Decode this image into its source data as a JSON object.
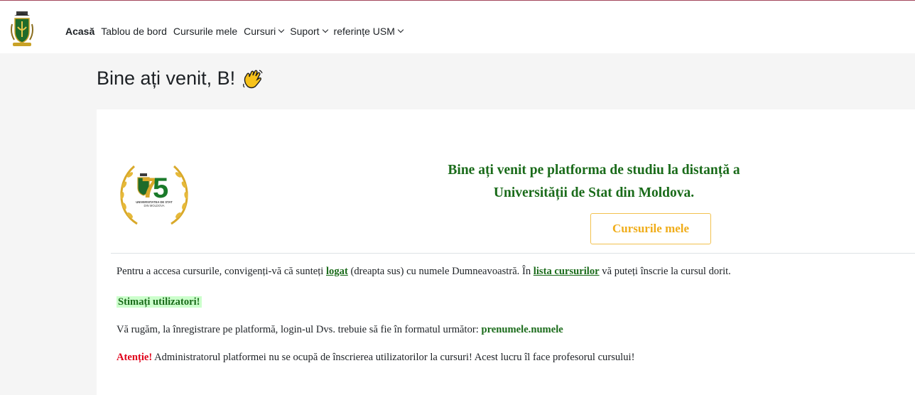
{
  "nav": {
    "items": [
      {
        "label": "Acasă"
      },
      {
        "label": "Tablou de bord"
      },
      {
        "label": "Cursurile mele"
      },
      {
        "label": "Cursuri"
      },
      {
        "label": "Suport"
      },
      {
        "label": "referințe USM"
      }
    ]
  },
  "page": {
    "title": "Bine ați venit, B!"
  },
  "card": {
    "emblem_text": [
      "UNIVERSITATEA DE STAT",
      "DIN MOLDOVA"
    ],
    "welcome": "Bine ați venit pe platforma de studiu la distanță a Universității de Stat din Moldova.",
    "button": "Cursurile mele",
    "p1_before": "Pentru a accesa cursurile, convigenți-vă că sunteți ",
    "p1_link1": "logat",
    "p1_middle": " (dreapta sus) cu numele Dumneavoastră. În ",
    "p1_link2": "lista cursurilor",
    "p1_after": " vă puteți înscrie la cursul dorit.",
    "p2": "Stimați utilizatori!",
    "p3_before": "Vă rugăm, la înregistrare pe platformă, login-ul Dvs. trebuie să fie în formatul următor: ",
    "p3_bold": "prenumele.numele",
    "p4_bold": "Atenție!",
    "p4_after": " Administratorul platformei nu se ocupă de înscrierea utilizatorilor la cursuri! Acest lucru îl face profesorul cursului!"
  },
  "colors": {
    "accent_green": "#1a6b1a",
    "button_gold": "#f0ad1a",
    "alert_red": "#e0001a",
    "highlight": "#ccffcc",
    "top_border": "#a3475c"
  },
  "icons": [
    "university-logo-icon",
    "waving-hand-icon",
    "chevron-down-icon",
    "anniversary-emblem-icon"
  ]
}
